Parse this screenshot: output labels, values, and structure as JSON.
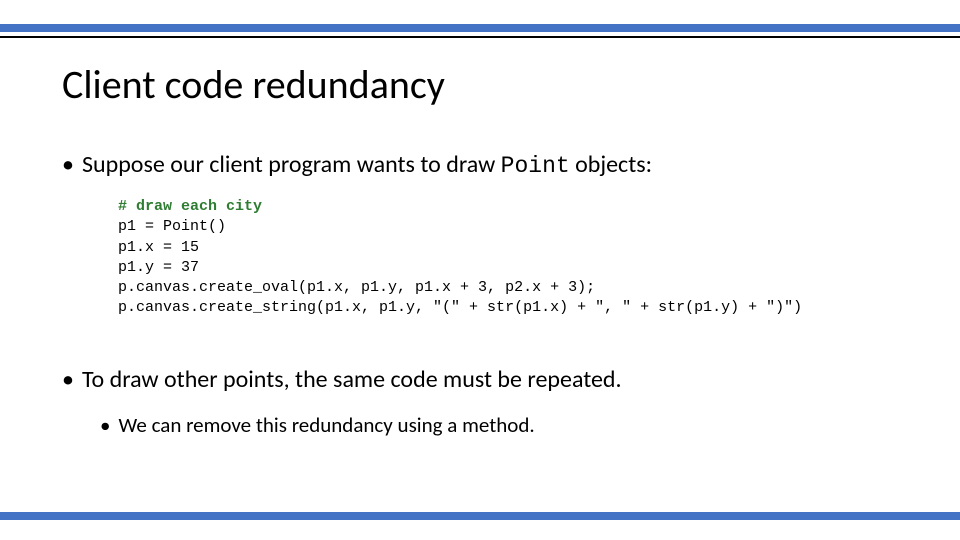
{
  "title": "Client code redundancy",
  "bullet1": {
    "prefix": "Suppose our client program wants to draw ",
    "code": "Point",
    "suffix": " objects:"
  },
  "code": {
    "comment": "# draw each city",
    "l1": "p1 = Point()",
    "l2": "p1.x = 15",
    "l3": "p1.y = 37",
    "l4": "p.canvas.create_oval(p1.x, p1.y, p1.x + 3, p2.x + 3);",
    "l5": "p.canvas.create_string(p1.x, p1.y, \"(\" + str(p1.x) + \", \" + str(p1.y) + \")\")"
  },
  "bullet2": "To draw other points, the same code must be repeated.",
  "sub_bullet": "We can remove this redundancy using a method."
}
